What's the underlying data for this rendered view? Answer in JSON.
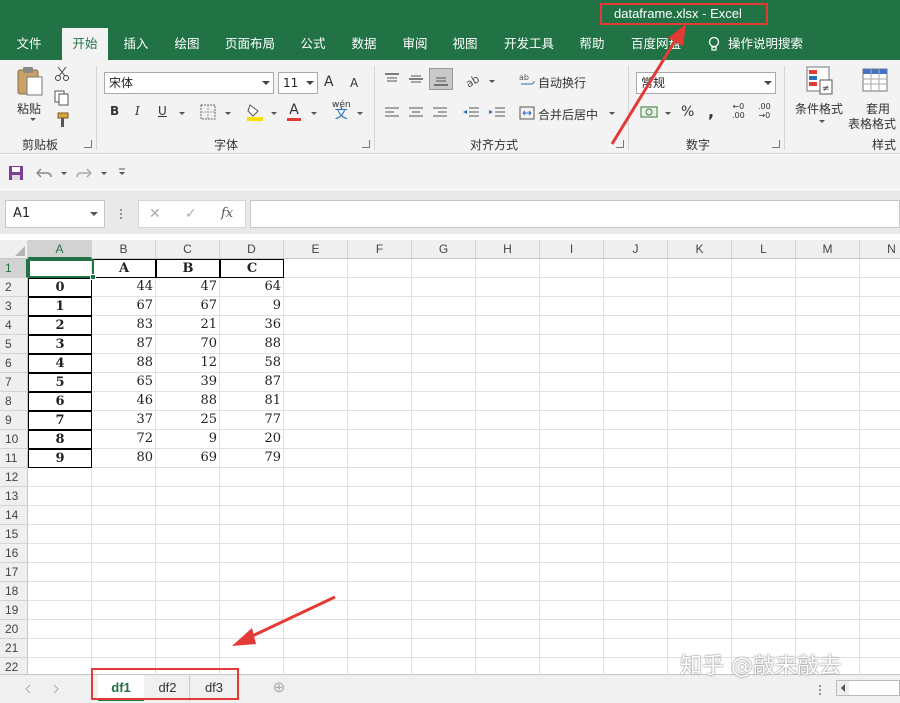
{
  "window": {
    "title": "dataframe.xlsx  -  Excel"
  },
  "menu": {
    "tabs": [
      "文件",
      "开始",
      "插入",
      "绘图",
      "页面布局",
      "公式",
      "数据",
      "审阅",
      "视图",
      "开发工具",
      "帮助",
      "百度网盘"
    ],
    "active": "开始",
    "tell_me": "操作说明搜索"
  },
  "ribbon": {
    "clipboard": {
      "paste": "粘贴",
      "label": "剪贴板"
    },
    "font": {
      "name": "宋体",
      "size": "11",
      "label": "字体",
      "grow": "A",
      "shrink": "A",
      "bold": "B",
      "italic": "I",
      "underline": "U",
      "phonetic": "wén",
      "phonetic_char": "文",
      "font_color": "A"
    },
    "alignment": {
      "wrap_text": "自动换行",
      "merge_center": "合并后居中",
      "label": "对齐方式"
    },
    "number": {
      "format": "常规",
      "percent": "%",
      "comma": ",",
      "inc_decimal_top": "←0",
      "inc_decimal_bottom": ".00",
      "dec_decimal_top": ".00",
      "dec_decimal_bottom": "→0",
      "label": "数字"
    },
    "styles": {
      "conditional": "条件格式",
      "table_format_line1": "套用",
      "table_format_line2": "表格格式",
      "label": "样式"
    }
  },
  "formula_bar": {
    "name_box": "A1",
    "fx": "fx",
    "cancel": "✕",
    "enter": "✓",
    "formula": ""
  },
  "sheet": {
    "columns": [
      "A",
      "B",
      "C",
      "D",
      "E",
      "F",
      "G",
      "H",
      "I",
      "J",
      "K",
      "L",
      "M",
      "N"
    ],
    "row_numbers": [
      "1",
      "2",
      "3",
      "4",
      "5",
      "6",
      "7",
      "8",
      "9",
      "10",
      "11",
      "12",
      "13",
      "14",
      "15",
      "16",
      "17",
      "18",
      "19",
      "20",
      "21",
      "22"
    ],
    "header_row": [
      "",
      "A",
      "B",
      "C"
    ],
    "data": [
      [
        "0",
        "44",
        "47",
        "64"
      ],
      [
        "1",
        "67",
        "67",
        "9"
      ],
      [
        "2",
        "83",
        "21",
        "36"
      ],
      [
        "3",
        "87",
        "70",
        "88"
      ],
      [
        "4",
        "88",
        "12",
        "58"
      ],
      [
        "5",
        "65",
        "39",
        "87"
      ],
      [
        "6",
        "46",
        "88",
        "81"
      ],
      [
        "7",
        "37",
        "25",
        "77"
      ],
      [
        "8",
        "72",
        "9",
        "20"
      ],
      [
        "9",
        "80",
        "69",
        "79"
      ]
    ]
  },
  "sheet_tabs": {
    "tabs": [
      "df1",
      "df2",
      "df3"
    ],
    "active": "df1",
    "add": "⊕"
  },
  "watermark": "知乎 @敲来敲去",
  "colors": {
    "excel_green": "#217346",
    "annotation_red": "#e53935"
  }
}
